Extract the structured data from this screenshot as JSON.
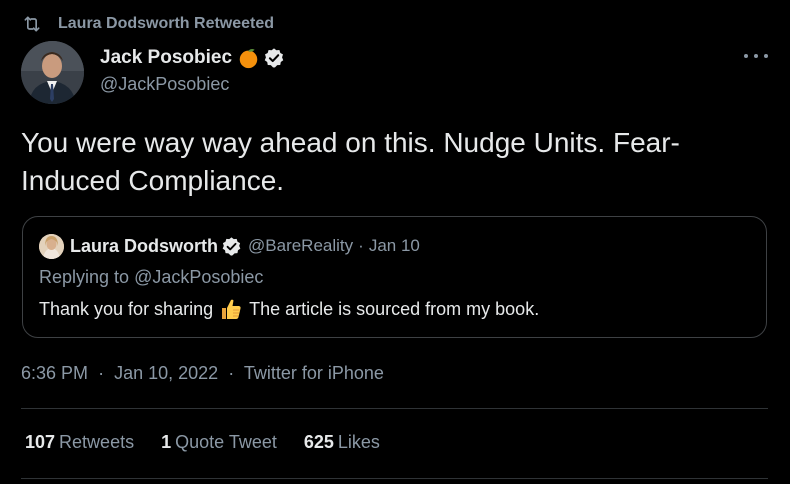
{
  "colors": {
    "background": "#000000",
    "text_primary": "#e7e9ea",
    "text_secondary": "#8b98a5",
    "verified_badge": "#e7e9ea",
    "divider": "#2f3336"
  },
  "retweet_banner": {
    "icon": "retweet-icon",
    "text": "Laura Dodsworth Retweeted"
  },
  "author": {
    "display_name": "Jack Posobiec",
    "name_emoji": "orange-emoji",
    "verified_icon": "verified-badge-icon",
    "handle": "@JackPosobiec"
  },
  "more_icon": "more-options-icon",
  "tweet": {
    "text": "You were way way ahead on this. Nudge Units. Fear-\nInduced Compliance."
  },
  "quoted_tweet": {
    "display_name": "Laura Dodsworth",
    "verified_icon": "verified-badge-icon",
    "handle": "@BareReality",
    "separator": "·",
    "date": "Jan 10",
    "replying_prefix": "Replying to",
    "replying_to": "@JackPosobiec",
    "body_before_emoji": "Thank you for sharing",
    "emoji": "thumbs-up-emoji",
    "body_after_emoji": "The article is sourced from my book."
  },
  "meta": {
    "time": "6:36 PM",
    "separator": "·",
    "date": "Jan 10, 2022",
    "source": "Twitter for iPhone"
  },
  "stats": {
    "retweets_count": "107",
    "retweets_label": "Retweets",
    "quotes_count": "1",
    "quotes_label": "Quote Tweet",
    "likes_count": "625",
    "likes_label": "Likes"
  }
}
